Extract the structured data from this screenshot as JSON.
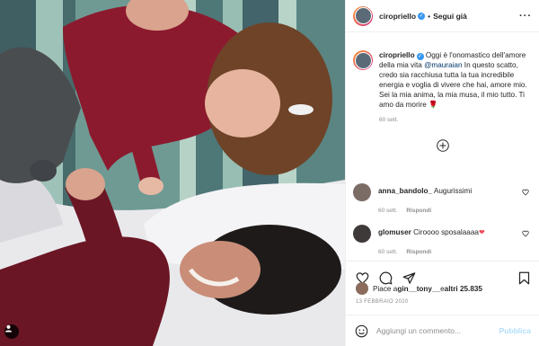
{
  "header": {
    "username": "ciropriello",
    "verified_mark": "✓",
    "separator": "•",
    "follow_label": "Segui già",
    "more_label": "···"
  },
  "caption": {
    "username": "ciropriello",
    "text_before": " Oggi è l'onomastico dell'amore della mia vita ",
    "mention": "@mauraian",
    "text_after": " In questo scatto, credo sia racchiusa tutta la tua incredibile energia e voglia di vivere che hai, amore mio. Sei la mia anima, la mia musa, il mio tutto. Ti amo da morire ",
    "emoji": "🌹",
    "time": "60 sett."
  },
  "comments": [
    {
      "username": "anna_bandolo_",
      "text": " Augurissimi",
      "time": "60 sett.",
      "reply": "Rispondi"
    },
    {
      "username": "glomuser",
      "text": " Ciroooo sposalaaaa",
      "emoji": "❤",
      "time": "60 sett.",
      "reply": "Rispondi"
    }
  ],
  "likes": {
    "prefix": "Piace a ",
    "user": "gin__tony__",
    "middle": " e ",
    "count": "altri 25.835"
  },
  "date": "13 FEBBRAIO 2020",
  "add_comment": {
    "placeholder": "Aggiungi un commento...",
    "publish_label": "Pubblica"
  },
  "icons": [
    "user-tag-icon",
    "verified-icon",
    "more-icon",
    "add-icon",
    "heart-icon",
    "comment-icon",
    "share-icon",
    "bookmark-icon",
    "emoji-icon"
  ],
  "colors": {
    "accent": "#3897f0",
    "mention": "#00376b",
    "muted": "#8e8e8e",
    "publish_disabled": "#b2dffc",
    "heart_red": "#ed4956"
  }
}
